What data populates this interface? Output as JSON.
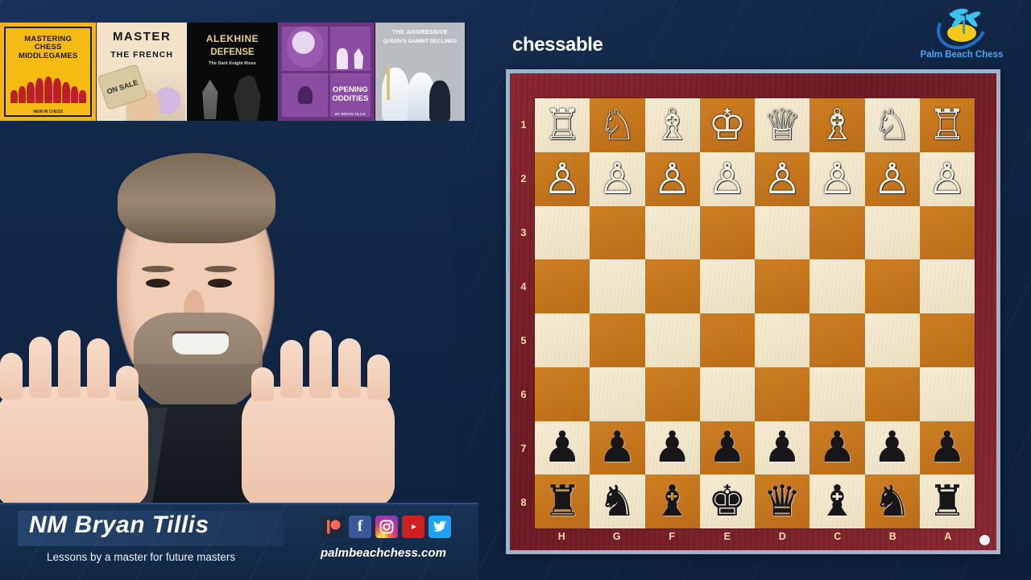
{
  "stream": {
    "platform_brand": "chessable",
    "org": {
      "name": "Palm Beach Chess",
      "logo_icon": "palm-tree-sun-icon"
    }
  },
  "books": [
    {
      "title_lines": [
        "MASTERING",
        "CHESS",
        "MIDDLEGAMES"
      ],
      "publisher": "NEW IN CHESS",
      "accent": "#f4b70f"
    },
    {
      "title_lines": [
        "MASTER",
        "THE FRENCH"
      ],
      "badge": "ON SALE",
      "accent": "#f2e2c8"
    },
    {
      "title_lines": [
        "ALEKHINE",
        "DEFENSE"
      ],
      "subtitle": "The Dark Knight Rises",
      "accent": "#e8cf84"
    },
    {
      "title_lines": [
        "OPENING",
        "ODDITIES"
      ],
      "author": "BY BRYAN TILLIS",
      "accent": "#8b4da2"
    },
    {
      "title_lines": [
        "THE AGGRESSIVE",
        "QUEEN'S GAMBIT DECLINED"
      ],
      "accent": "#b9bcc0"
    }
  ],
  "lower_third": {
    "name": "NM Bryan Tillis",
    "tagline": "Lessons by a master for future masters",
    "website": "palmbeachchess.com",
    "socials": [
      {
        "name": "patreon",
        "glyph": "Ⓟ",
        "color": "#f96854"
      },
      {
        "name": "facebook",
        "glyph": "f",
        "color": "#3b5998"
      },
      {
        "name": "instagram",
        "glyph": "▢",
        "color": "#d32e8f"
      },
      {
        "name": "youtube",
        "glyph": "▶",
        "color": "#cd201f"
      },
      {
        "name": "twitter",
        "glyph": "ᴠ",
        "color": "#1da1f2"
      }
    ]
  },
  "chessboard": {
    "orientation": "black-perspective",
    "files": [
      "H",
      "G",
      "F",
      "E",
      "D",
      "C",
      "B",
      "A"
    ],
    "ranks": [
      "1",
      "2",
      "3",
      "4",
      "5",
      "6",
      "7",
      "8"
    ],
    "turn_indicator": "white",
    "colors": {
      "light_square": "#f2e6cb",
      "dark_square": "#c8761e",
      "frame": "#8b2430",
      "border": "#9fb3cc",
      "label": "#f3dfa8"
    },
    "position_name": "starting position",
    "rows": [
      {
        "rank": "1",
        "pieces": [
          "♖",
          "♘",
          "♗",
          "♔",
          "♕",
          "♗",
          "♘",
          "♖"
        ],
        "side": "w"
      },
      {
        "rank": "2",
        "pieces": [
          "♙",
          "♙",
          "♙",
          "♙",
          "♙",
          "♙",
          "♙",
          "♙"
        ],
        "side": "w"
      },
      {
        "rank": "3",
        "pieces": [
          "",
          "",
          "",
          "",
          "",
          "",
          "",
          ""
        ],
        "side": ""
      },
      {
        "rank": "4",
        "pieces": [
          "",
          "",
          "",
          "",
          "",
          "",
          "",
          ""
        ],
        "side": ""
      },
      {
        "rank": "5",
        "pieces": [
          "",
          "",
          "",
          "",
          "",
          "",
          "",
          ""
        ],
        "side": ""
      },
      {
        "rank": "6",
        "pieces": [
          "",
          "",
          "",
          "",
          "",
          "",
          "",
          ""
        ],
        "side": ""
      },
      {
        "rank": "7",
        "pieces": [
          "♟",
          "♟",
          "♟",
          "♟",
          "♟",
          "♟",
          "♟",
          "♟"
        ],
        "side": "b"
      },
      {
        "rank": "8",
        "pieces": [
          "♜",
          "♞",
          "♝",
          "♚",
          "♛",
          "♝",
          "♞",
          "♜"
        ],
        "side": "b"
      }
    ]
  },
  "webcam": {
    "subject": "NM Bryan Tillis",
    "pose": "both-hands-raised"
  }
}
